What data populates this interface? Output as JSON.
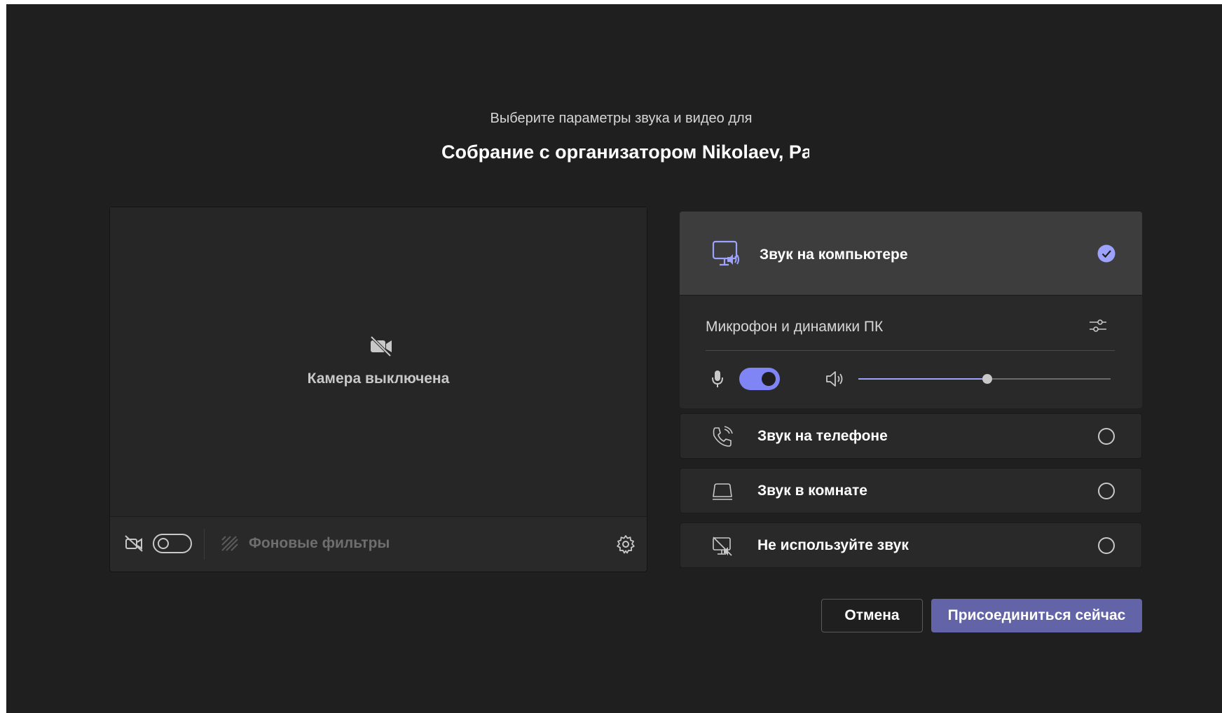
{
  "header": {
    "subtitle": "Выберите параметры звука и видео для",
    "title": "Собрание с организатором Nikolaev, Pa"
  },
  "video": {
    "camera_off_label": "Камера выключена",
    "camera_enabled": false,
    "background_filters_label": "Фоновые фильтры"
  },
  "audio": {
    "computer": {
      "label": "Звук на компьютере",
      "selected": true,
      "device_name": "Микрофон и динамики ПК",
      "mic_on": true,
      "volume_fraction": 0.51
    },
    "options": [
      {
        "label": "Звук на телефоне",
        "icon": "phone-icon",
        "selected": false
      },
      {
        "label": "Звук в комнате",
        "icon": "room-icon",
        "selected": false
      },
      {
        "label": "Не используйте звук",
        "icon": "no-audio-icon",
        "selected": false
      }
    ]
  },
  "actions": {
    "cancel_label": "Отмена",
    "join_label": "Присоединиться сейчас"
  },
  "colors": {
    "background": "#1f1f1f",
    "accent": "#7f85f5",
    "join_button": "#6264a7"
  }
}
